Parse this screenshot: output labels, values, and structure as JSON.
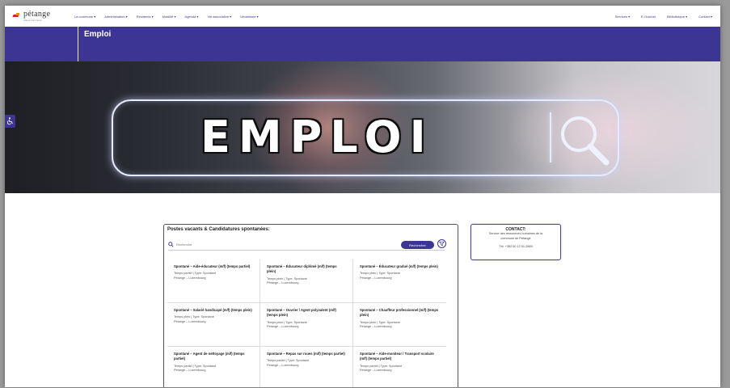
{
  "header": {
    "logo_text": "pétange",
    "logo_subtitle": "ville et commune",
    "menu": [
      "La commune ▾",
      "Administration ▾",
      "Résidents ▾",
      "Mobilité ▾",
      "Agenda ▾",
      "Vie associative ▾",
      "Urbanisme ▾"
    ],
    "menu_right": [
      "Services ▾",
      "E-Guichet",
      "Bibliothèque ▾",
      "Contact ▾"
    ]
  },
  "page": {
    "title": "Emploi"
  },
  "hero": {
    "text": "EMPLOI",
    "icon": "magnifier-icon"
  },
  "jobs": {
    "title": "Postes vacants & Candidatures spontanées:",
    "search_placeholder": "Recherche",
    "search_button": "Rechercher",
    "cards": [
      {
        "title": "Spontané – Aide-éducateur (m/f) (temps partiel)",
        "meta": "Temps partiel | Type: Spontané",
        "location": "Pétange – Luxembourg"
      },
      {
        "title": "Spontané – Éducateur diplômé (m/f) (temps plein)",
        "meta": "Temps plein | Type: Spontané",
        "location": "Pétange – Luxembourg"
      },
      {
        "title": "Spontané – Éducateur gradué (m/f) (temps plein)",
        "meta": "Temps plein | Type: Spontané",
        "location": "Pétange – Luxembourg"
      },
      {
        "title": "Spontané – Salarié handicapé (m/f) (temps plein)",
        "meta": "Temps plein | Type: Spontané",
        "location": "Pétange – Luxembourg"
      },
      {
        "title": "Spontané – Ouvrier / Agent polyvalent (m/f) (temps plein)",
        "meta": "Temps plein | Type: Spontané",
        "location": "Pétange – Luxembourg"
      },
      {
        "title": "Spontané – Chauffeur professionnel (m/f) (temps plein)",
        "meta": "Temps plein | Type: Spontané",
        "location": "Pétange – Luxembourg"
      },
      {
        "title": "Spontané – Agent de nettoyage (m/f) (temps partiel)",
        "meta": "Temps partiel | Type: Spontané",
        "location": "Pétange – Luxembourg"
      },
      {
        "title": "Spontané – Repas sur roues (m/f) (temps partiel)",
        "meta": "Temps partiel | Type: Spontané",
        "location": "Pétange – Luxembourg"
      },
      {
        "title": "Spontané – Aide-moniteur / Transport scolaire (m/f) (temps partiel)",
        "meta": "Temps partiel | Type: Spontané",
        "location": "Pétange – Luxembourg"
      }
    ]
  },
  "contact": {
    "title": "CONTACT:",
    "service_line1": "Service des ressources humaines de la",
    "service_line2": "commune de Pétange",
    "tel": "Tél. +352 50 12 51-2869"
  },
  "colors": {
    "brand": "#3c3593",
    "logo_red": "#d8232a",
    "logo_orange": "#f39200"
  }
}
